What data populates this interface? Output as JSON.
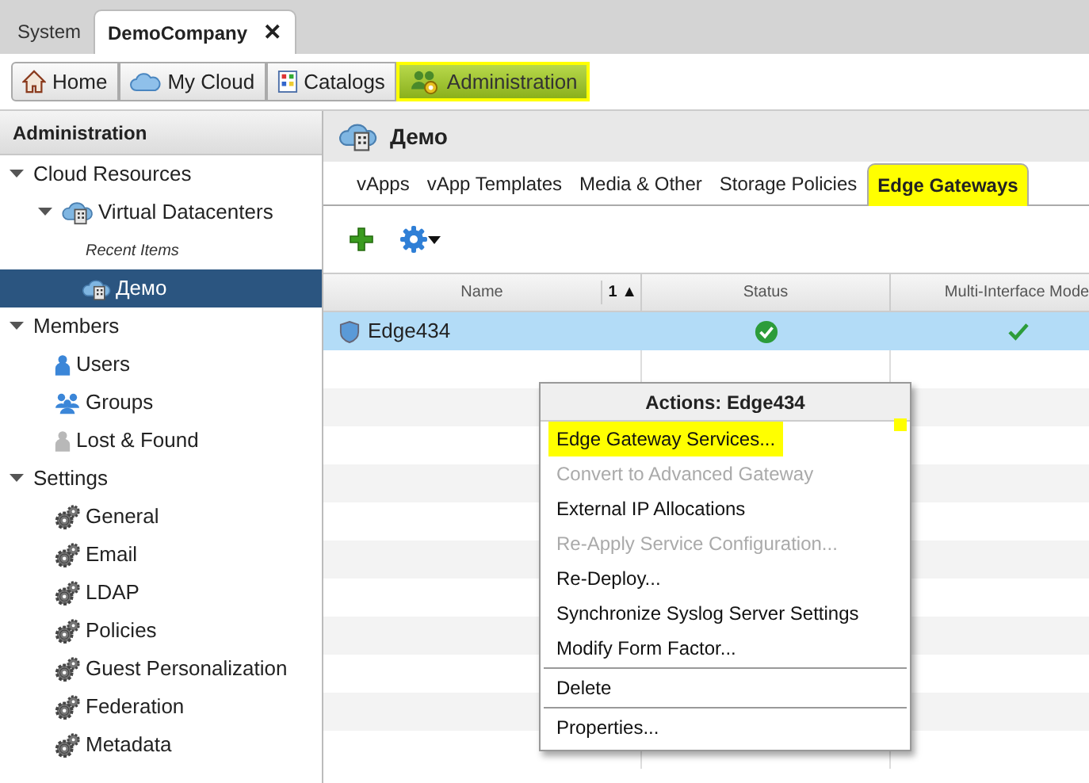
{
  "top_tabs": [
    {
      "label": "System",
      "selected": false
    },
    {
      "label": "DemoCompany",
      "selected": true,
      "close": "✕"
    }
  ],
  "nav": [
    {
      "label": "Home",
      "kind": "home",
      "selected": false
    },
    {
      "label": "My Cloud",
      "kind": "cloud",
      "selected": false
    },
    {
      "label": "Catalogs",
      "kind": "catalog",
      "selected": false
    },
    {
      "label": "Administration",
      "kind": "admin",
      "selected": true
    }
  ],
  "sidebar": {
    "title": "Administration",
    "items": [
      {
        "label": "Cloud Resources",
        "kind": "group",
        "expanded": true,
        "children": [
          {
            "label": "Virtual Datacenters",
            "kind": "vdc",
            "expanded": true,
            "selected": false,
            "children": [
              {
                "label": "Recent Items",
                "kind": "caption"
              },
              {
                "label": "Демо",
                "kind": "vdc-item",
                "selected": true
              }
            ]
          }
        ]
      },
      {
        "label": "Members",
        "kind": "group",
        "expanded": true,
        "children": [
          {
            "label": "Users",
            "kind": "user",
            "selected": false
          },
          {
            "label": "Groups",
            "kind": "users",
            "selected": false
          },
          {
            "label": "Lost & Found",
            "kind": "lost",
            "selected": false
          }
        ]
      },
      {
        "label": "Settings",
        "kind": "group",
        "expanded": true,
        "children": [
          {
            "label": "General",
            "kind": "setting",
            "selected": false
          },
          {
            "label": "Email",
            "kind": "setting",
            "selected": false
          },
          {
            "label": "LDAP",
            "kind": "setting",
            "selected": false
          },
          {
            "label": "Policies",
            "kind": "setting",
            "selected": false
          },
          {
            "label": "Guest Personalization",
            "kind": "setting",
            "selected": false
          },
          {
            "label": "Federation",
            "kind": "setting",
            "selected": false
          },
          {
            "label": "Metadata",
            "kind": "setting",
            "selected": false
          }
        ]
      }
    ]
  },
  "content": {
    "title": "Демо",
    "tabs": [
      {
        "label": "vApps",
        "selected": false
      },
      {
        "label": "vApp Templates",
        "selected": false
      },
      {
        "label": "Media & Other",
        "selected": false
      },
      {
        "label": "Storage Policies",
        "selected": false
      },
      {
        "label": "Edge Gateways",
        "selected": true
      }
    ],
    "table": {
      "columns": [
        {
          "label": "Name",
          "sort": "1 ▲"
        },
        {
          "label": "Status"
        },
        {
          "label": "Multi-Interface Mode"
        }
      ],
      "rows": [
        {
          "name": "Edge434",
          "status_ok": true,
          "multi_interface": true,
          "selected": true
        }
      ]
    },
    "context_menu": {
      "title": "Actions: Edge434",
      "items": [
        {
          "label": "Edge Gateway Services...",
          "disabled": false,
          "highlighted": true,
          "separator_before": false
        },
        {
          "label": "Convert to Advanced Gateway",
          "disabled": true,
          "highlighted": false,
          "separator_before": false
        },
        {
          "label": "External IP Allocations",
          "disabled": false,
          "highlighted": false,
          "separator_before": false
        },
        {
          "label": "Re-Apply Service Configuration...",
          "disabled": true,
          "highlighted": false,
          "separator_before": false
        },
        {
          "label": "Re-Deploy...",
          "disabled": false,
          "highlighted": false,
          "separator_before": false
        },
        {
          "label": "Synchronize Syslog Server Settings",
          "disabled": false,
          "highlighted": false,
          "separator_before": false
        },
        {
          "label": "Modify Form Factor...",
          "disabled": false,
          "highlighted": false,
          "separator_before": false
        },
        {
          "label": "Delete",
          "disabled": false,
          "highlighted": false,
          "separator_before": true
        },
        {
          "label": "Properties...",
          "disabled": false,
          "highlighted": false,
          "separator_before": true
        }
      ]
    }
  }
}
